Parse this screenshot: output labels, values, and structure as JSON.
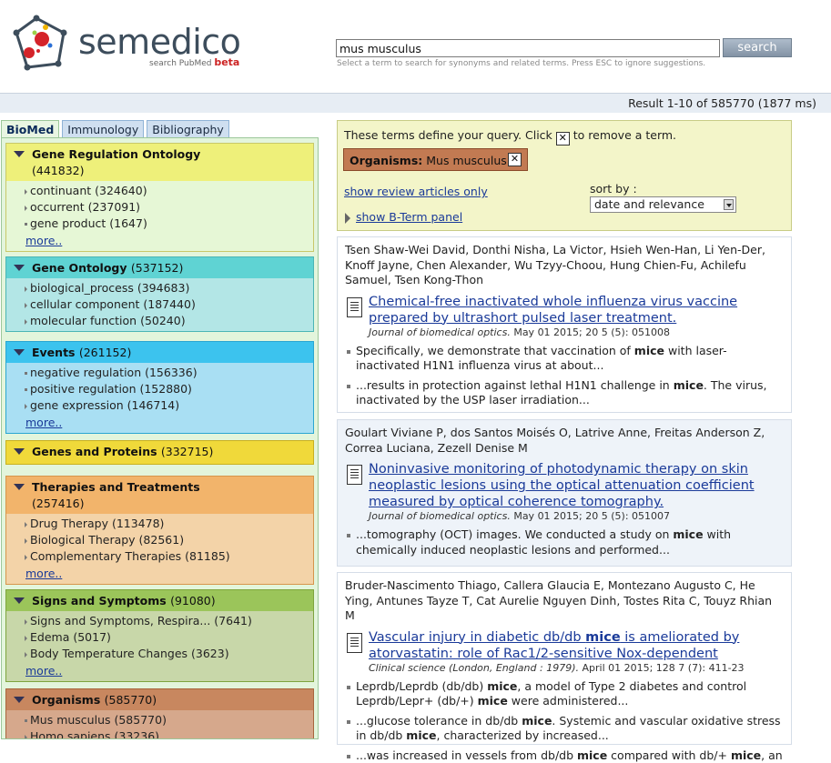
{
  "header": {
    "logo_word": "semedico",
    "logo_tagline": "search PubMed",
    "logo_beta": "beta",
    "search_value": "mus musculus",
    "search_button": "search",
    "search_hint": "Select a term to search for synonyms and related terms. Press ESC to ignore suggestions."
  },
  "result_summary": "Result 1-10 of 585770 (1877 ms)",
  "tabs": [
    "BioMed",
    "Immunology",
    "Bibliography"
  ],
  "facets": [
    {
      "name": "Gene Regulation Ontology",
      "count": "(441832)",
      "color": "#eef07a",
      "body_color": "#e6f7d6",
      "items": [
        "continuant (324640)",
        "occurrent (237091)",
        "gene product (1647)"
      ],
      "more": "more.."
    },
    {
      "name": "Gene Ontology",
      "count": "(537152)",
      "color": "#5fd3d3",
      "body_color": "#b3e6e6",
      "items": [
        "biological_process (394683)",
        "cellular component (187440)",
        "molecular function (50240)"
      ]
    },
    {
      "name": "Events",
      "count": "(261152)",
      "color": "#3cc3ee",
      "body_color": "#a9dff3",
      "items": [
        "negative regulation (156336)",
        "positive regulation (152880)",
        "gene expression (146714)"
      ],
      "more": "more.."
    },
    {
      "name": "Genes and Proteins",
      "count": "(332715)",
      "color": "#f0d93a"
    },
    {
      "name": "Therapies and Treatments",
      "count": "(257416)",
      "color": "#f2b46b",
      "body_color": "#f3d3a8",
      "items": [
        "Drug Therapy (113478)",
        "Biological Therapy (82561)",
        "Complementary Therapies (81185)"
      ],
      "more": "more.."
    },
    {
      "name": "Signs and Symptoms",
      "count": "(91080)",
      "color": "#9bc55a",
      "body_color": "#c8d7a9",
      "items": [
        "Signs and Symptoms, Respira... (7641)",
        "Edema (5017)",
        "Body Temperature Changes (3623)"
      ],
      "more": "more.."
    },
    {
      "name": "Organisms",
      "count": "(585770)",
      "color": "#c8875f",
      "body_color": "#d6a88c",
      "items": [
        "Mus musculus (585770)",
        "Homo sapiens (33236)"
      ]
    }
  ],
  "query": {
    "label_before": "These terms define your query. Click",
    "label_after": "to remove a term.",
    "term_category": "Organisms:",
    "term_value": "Mus musculus",
    "remove_glyph": "✕",
    "review_link": "show review articles only",
    "bterm_link": "show B-Term panel",
    "sort_label": "sort by :",
    "sort_value": "date and relevance"
  },
  "results": [
    {
      "authors": "Tsen Shaw-Wei David, Donthi Nisha, La Victor, Hsieh Wen-Han, Li Yen-Der, Knoff Jayne, Chen Alexander, Wu Tzyy-Choou, Hung Chien-Fu, Achilefu Samuel, Tsen Kong-Thon",
      "title": "Chemical-free inactivated whole influenza virus vaccine prepared by ultrashort pulsed laser treatment.",
      "journal": "Journal of biomedical optics.",
      "journal_rest": " May 01 2015; 20 5 (5): 051008",
      "snippets": [
        {
          "pre": "Specifically, we demonstrate that vaccination of ",
          "hit": "mice",
          "post": " with laser-inactivated H1N1 influenza virus at about..."
        },
        {
          "pre": "...results in protection against lethal H1N1 challenge in ",
          "hit": "mice",
          "post": ". The virus, inactivated by the USP laser irradiation..."
        }
      ]
    },
    {
      "authors": "Goulart Viviane P, dos Santos Moisés O, Latrive Anne, Freitas Anderson Z, Correa Luciana, Zezell Denise M",
      "title": "Noninvasive monitoring of photodynamic therapy on skin neoplastic lesions using the optical attenuation coefficient measured by optical coherence tomography.",
      "journal": "Journal of biomedical optics.",
      "journal_rest": " May 01 2015; 20 5 (5): 051007",
      "snippets": [
        {
          "pre": "...tomography (OCT) images. We conducted a study on ",
          "hit": "mice",
          "post": " with chemically induced neoplastic lesions and performed..."
        }
      ]
    },
    {
      "authors": "Bruder-Nascimento Thiago, Callera Glaucia E, Montezano Augusto C, He Ying, Antunes Tayze T, Cat Aurelie Nguyen Dinh, Tostes Rita C, Touyz Rhian M",
      "title_pre": "Vascular injury in diabetic db/db ",
      "title_hit": "mice",
      "title_post": " is ameliorated by atorvastatin: role of Rac1/2-sensitive Nox-dependent",
      "journal": "Clinical science (London, England : 1979).",
      "journal_rest": " April 01 2015; 128 7 (7): 411-23",
      "snippets": [
        {
          "pre": "Leprdb/Leprdb (db/db) ",
          "hit": "mice",
          "post": ", a model of Type 2 diabetes and control Leprdb/Lepr+ (db/+) "
        },
        {
          "pre": "...glucose tolerance in db/db ",
          "hit": "mice",
          "post": ". Systemic and vascular oxidative stress in db/db "
        },
        {
          "pre": "...was increased in vessels from db/db ",
          "hit": "mice",
          "post": " compared with db/+ "
        }
      ]
    }
  ],
  "extra": {
    "r3_s1_hit2": "mice",
    "r3_s1_tail": " were administered...",
    "r3_s2_hit2": "mice",
    "r3_s2_tail": ", characterized by increased...",
    "r3_s3_hit2": "mice",
    "r3_s3_tail": ", an"
  }
}
